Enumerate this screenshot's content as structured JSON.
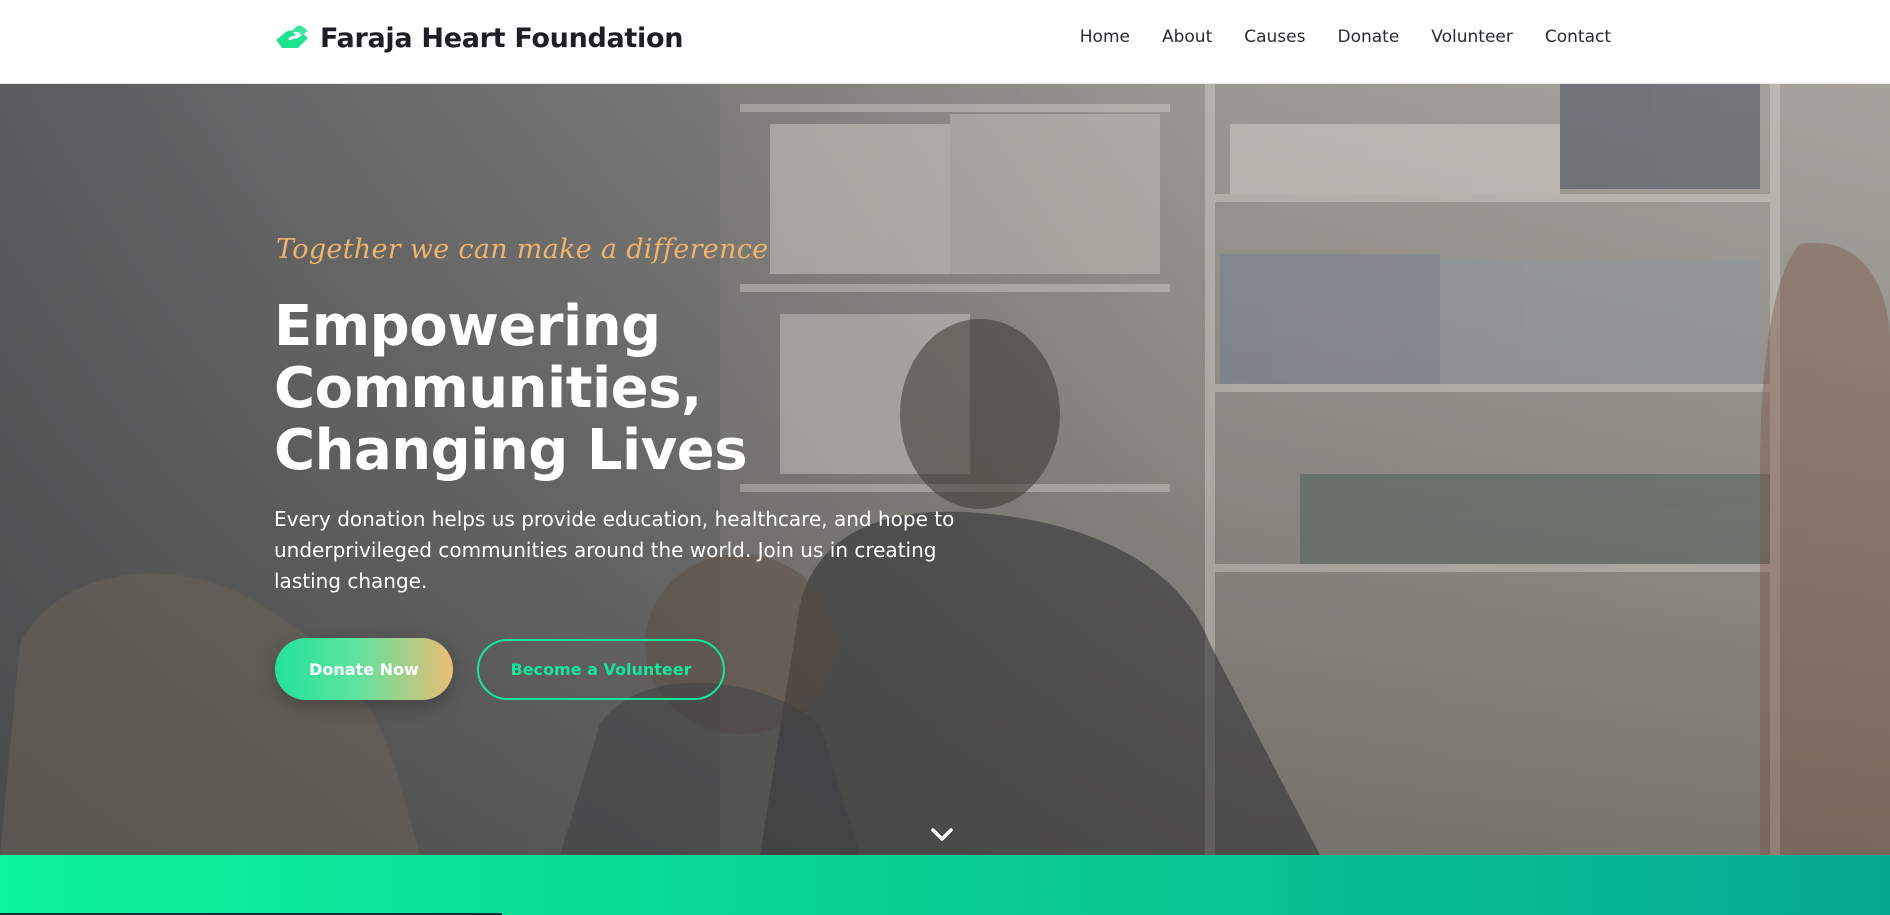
{
  "brand": {
    "name": "Faraja Heart Foundation",
    "icon": "hands-heart-icon",
    "icon_color": "#1ee28f"
  },
  "nav": {
    "items": [
      {
        "label": "Home"
      },
      {
        "label": "About"
      },
      {
        "label": "Causes"
      },
      {
        "label": "Donate"
      },
      {
        "label": "Volunteer"
      },
      {
        "label": "Contact"
      }
    ]
  },
  "hero": {
    "tagline": "Together we can make a difference",
    "headline_lines": [
      "Empowering",
      "Communities,",
      "Changing Lives"
    ],
    "lead": "Every donation helps us provide education, healthcare, and hope to underprivileged communities around the world. Join us in creating lasting change.",
    "primary_cta": "Donate Now",
    "secondary_cta": "Become a Volunteer",
    "scroll_icon": "chevron-down-icon"
  },
  "colors": {
    "accent_green": "#15e79a",
    "accent_orange": "#f0b36a",
    "band_start": "#0cf59b",
    "band_end": "#05a990"
  }
}
